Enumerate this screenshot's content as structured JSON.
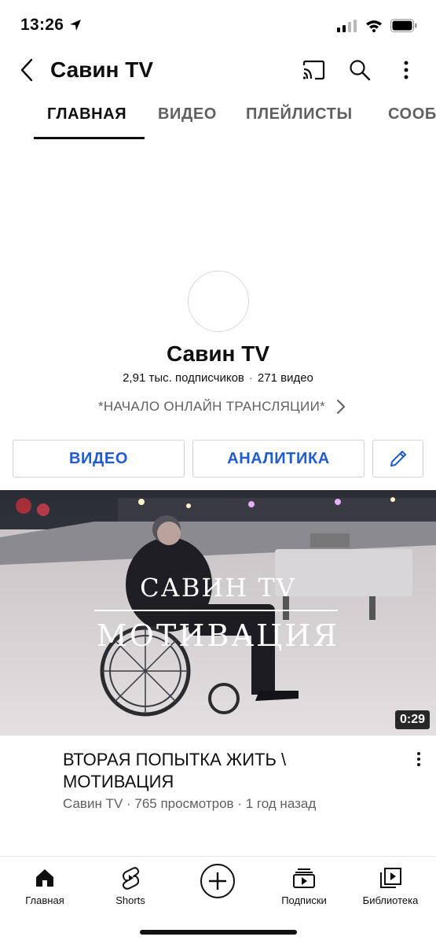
{
  "status_bar": {
    "time": "13:26"
  },
  "header": {
    "title": "Савин TV"
  },
  "tabs": [
    {
      "label": "ГЛАВНАЯ",
      "active": true
    },
    {
      "label": "ВИДЕО",
      "active": false
    },
    {
      "label": "ПЛЕЙЛИСТЫ",
      "active": false
    },
    {
      "label": "СООБ",
      "active": false
    }
  ],
  "channel": {
    "name": "Савин TV",
    "subscribers": "2,91 тыс. подписчиков",
    "separator": "·",
    "video_count": "271 видео",
    "link_text": "*НАЧАЛО ОНЛАЙН ТРАНСЛЯЦИИ*"
  },
  "actions": {
    "video_label": "ВИДЕО",
    "analytics_label": "АНАЛИТИКА",
    "edit_icon": "pencil-icon"
  },
  "video": {
    "overlay_line1": "САВИН TV",
    "overlay_line2": "МОТИВАЦИЯ",
    "duration": "0:29",
    "title": "ВТОРАЯ ПОПЫТКА ЖИТЬ \\ МОТИВАЦИЯ",
    "meta": "Савин TV · 765 просмотров · 1 год назад"
  },
  "bottom_nav": [
    {
      "label": "Главная",
      "icon": "home-icon"
    },
    {
      "label": "Shorts",
      "icon": "shorts-icon"
    },
    {
      "label": "",
      "icon": "create-icon"
    },
    {
      "label": "Подписки",
      "icon": "subscriptions-icon"
    },
    {
      "label": "Библиотека",
      "icon": "library-icon"
    }
  ],
  "colors": {
    "accent_blue": "#1f5bd1",
    "text_primary": "#0f0f0f",
    "text_secondary": "#606060"
  }
}
